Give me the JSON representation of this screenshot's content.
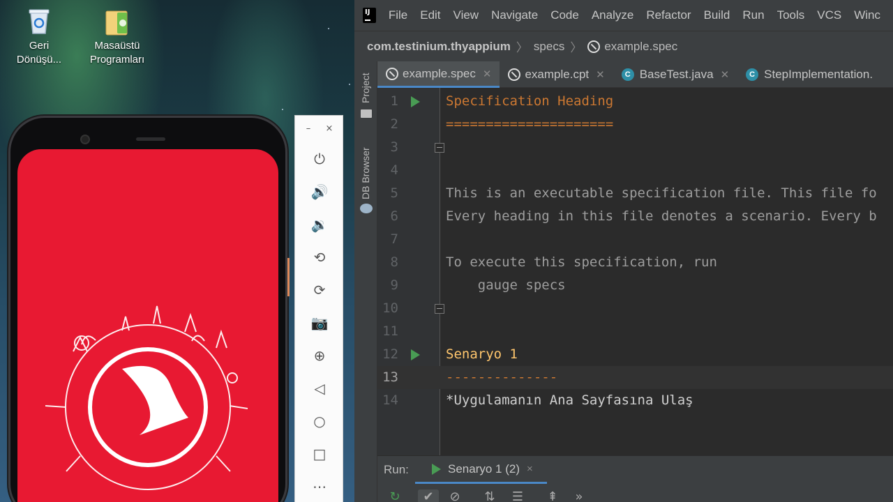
{
  "desktop": {
    "icons": [
      {
        "label": "Geri Dönüşü...",
        "icon": "recycle-bin-icon"
      },
      {
        "label": "Masaüstü Programları",
        "icon": "folder-icon"
      }
    ]
  },
  "emulator": {
    "window": {
      "minimize": "–",
      "close": "×"
    },
    "controls": [
      {
        "name": "power-icon",
        "glyph": "⏻"
      },
      {
        "name": "volume-up-icon",
        "glyph": "🔊"
      },
      {
        "name": "volume-down-icon",
        "glyph": "🔉"
      },
      {
        "name": "rotate-left-icon",
        "glyph": "⟲"
      },
      {
        "name": "rotate-right-icon",
        "glyph": "⟳"
      },
      {
        "name": "camera-icon",
        "glyph": "📷"
      },
      {
        "name": "zoom-icon",
        "glyph": "⊕"
      },
      {
        "name": "back-icon",
        "glyph": "◁"
      },
      {
        "name": "home-icon",
        "glyph": "○"
      },
      {
        "name": "overview-icon",
        "glyph": "□"
      },
      {
        "name": "more-icon",
        "glyph": "⋯"
      }
    ],
    "screen_color": "#e81932"
  },
  "ide": {
    "menu": [
      "File",
      "Edit",
      "View",
      "Navigate",
      "Code",
      "Analyze",
      "Refactor",
      "Build",
      "Run",
      "Tools",
      "VCS",
      "Winc"
    ],
    "breadcrumb": {
      "root": "com.testinium.thyappium",
      "folder": "specs",
      "file": "example.spec"
    },
    "left_tools": {
      "project": "Project",
      "db": "DB Browser"
    },
    "tabs": [
      {
        "label": "example.spec",
        "icon": "gauge-spec-icon",
        "active": true
      },
      {
        "label": "example.cpt",
        "icon": "gauge-spec-icon",
        "active": false
      },
      {
        "label": "BaseTest.java",
        "icon": "java-class-icon",
        "active": false
      },
      {
        "label": "StepImplementation.",
        "icon": "java-class-icon",
        "active": false
      }
    ],
    "editor": {
      "current_line": 13,
      "lines": [
        {
          "n": "1",
          "text": "Specification Heading",
          "style": "head",
          "run": true,
          "fold": false
        },
        {
          "n": "2",
          "text": "=====================",
          "style": "head",
          "run": false,
          "fold": false
        },
        {
          "n": "3",
          "text": "",
          "style": "text",
          "run": false,
          "fold": true
        },
        {
          "n": "4",
          "text": "",
          "style": "text",
          "run": false,
          "fold": false
        },
        {
          "n": "5",
          "text": "This is an executable specification file. This file fo",
          "style": "text",
          "run": false,
          "fold": false
        },
        {
          "n": "6",
          "text": "Every heading in this file denotes a scenario. Every b",
          "style": "text",
          "run": false,
          "fold": false
        },
        {
          "n": "7",
          "text": "",
          "style": "text",
          "run": false,
          "fold": false
        },
        {
          "n": "8",
          "text": "To execute this specification, run",
          "style": "text",
          "run": false,
          "fold": false
        },
        {
          "n": "9",
          "text": "    gauge specs",
          "style": "text",
          "run": false,
          "fold": false
        },
        {
          "n": "10",
          "text": "",
          "style": "text",
          "run": false,
          "fold": true
        },
        {
          "n": "11",
          "text": "",
          "style": "text",
          "run": false,
          "fold": false
        },
        {
          "n": "12",
          "text": "Senaryo 1",
          "style": "scen",
          "run": true,
          "fold": false
        },
        {
          "n": "13",
          "text": "--------------",
          "style": "head",
          "run": false,
          "fold": false
        },
        {
          "n": "14",
          "text": "*Uygulamanın Ana Sayfasına Ulaş",
          "style": "step",
          "run": false,
          "fold": false
        }
      ]
    },
    "run_panel": {
      "label": "Run:",
      "tab": "Senaryo 1 (2)",
      "tab_close": "×",
      "more": "»"
    },
    "colors": {
      "accent": "#4a88c7",
      "run_green": "#499c54",
      "keyword": "#cc7832",
      "scenario": "#ffc66d"
    }
  }
}
